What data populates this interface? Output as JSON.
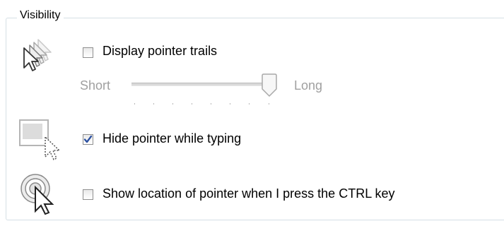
{
  "visibility": {
    "group_title": "Visibility",
    "pointer_trails": {
      "label": "Display pointer trails",
      "checked": false,
      "slider": {
        "min_label": "Short",
        "max_label": "Long",
        "value_fraction": 1.0,
        "enabled": false
      }
    },
    "hide_while_typing": {
      "label": "Hide pointer while typing",
      "checked": true
    },
    "show_location": {
      "label": "Show location of pointer when I press the CTRL key",
      "checked": false
    }
  },
  "colors": {
    "check_mark": "#2a4fa0",
    "disabled_text": "#a0a0a0",
    "group_border": "#d5dfe5"
  }
}
